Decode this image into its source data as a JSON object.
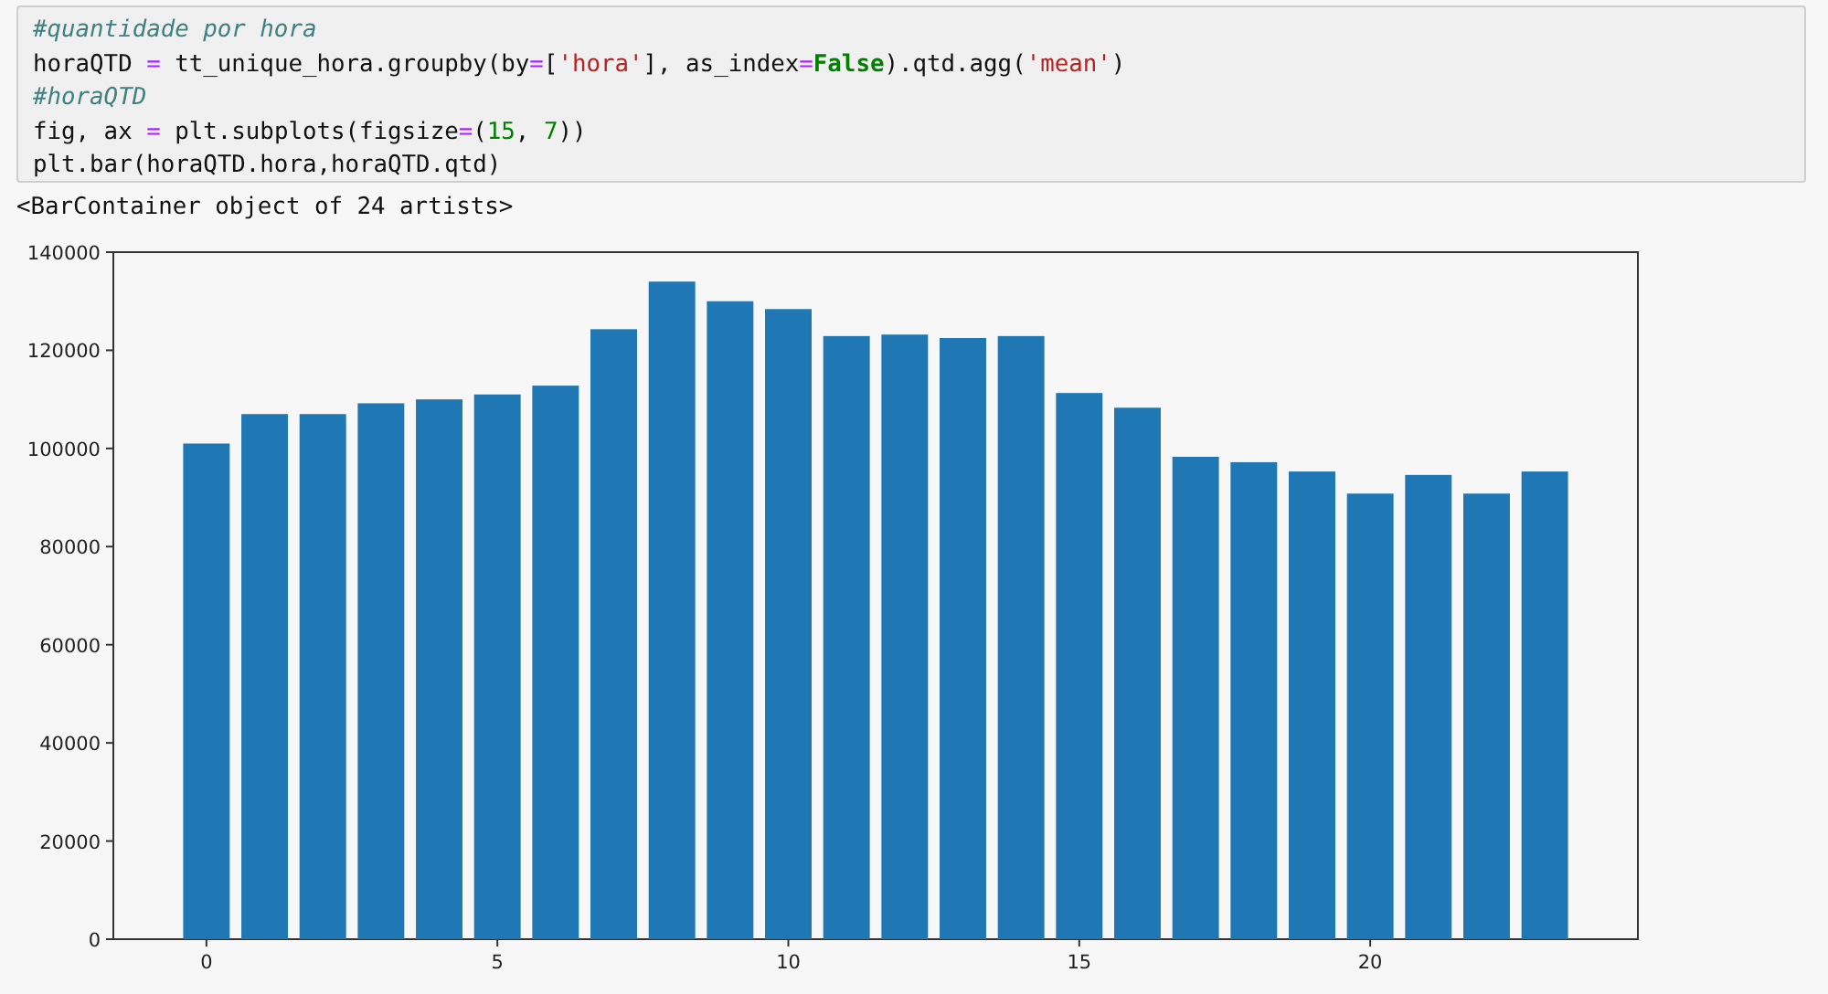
{
  "code_cell": {
    "lines": [
      [
        {
          "kind": "comment",
          "text": "#quantidade por hora"
        }
      ],
      [
        {
          "kind": "plain",
          "text": "horaQTD "
        },
        {
          "kind": "op",
          "text": "="
        },
        {
          "kind": "plain",
          "text": " tt_unique_hora.groupby(by"
        },
        {
          "kind": "op",
          "text": "="
        },
        {
          "kind": "plain",
          "text": "["
        },
        {
          "kind": "string",
          "text": "'hora'"
        },
        {
          "kind": "plain",
          "text": "], as_index"
        },
        {
          "kind": "op",
          "text": "="
        },
        {
          "kind": "keyword",
          "text": "False"
        },
        {
          "kind": "plain",
          "text": ").qtd.agg("
        },
        {
          "kind": "string",
          "text": "'mean'"
        },
        {
          "kind": "plain",
          "text": ")"
        }
      ],
      [
        {
          "kind": "comment",
          "text": "#horaQTD"
        }
      ],
      [
        {
          "kind": "plain",
          "text": "fig, ax "
        },
        {
          "kind": "op",
          "text": "="
        },
        {
          "kind": "plain",
          "text": " plt.subplots(figsize"
        },
        {
          "kind": "op",
          "text": "="
        },
        {
          "kind": "plain",
          "text": "("
        },
        {
          "kind": "number",
          "text": "15"
        },
        {
          "kind": "plain",
          "text": ", "
        },
        {
          "kind": "number",
          "text": "7"
        },
        {
          "kind": "plain",
          "text": "))"
        }
      ],
      [
        {
          "kind": "plain",
          "text": "plt.bar(horaQTD.hora,horaQTD.qtd)"
        }
      ]
    ]
  },
  "output": {
    "text": "<BarContainer object of 24 artists>",
    "chart_data": {
      "type": "bar",
      "x": [
        0,
        1,
        2,
        3,
        4,
        5,
        6,
        7,
        8,
        9,
        10,
        11,
        12,
        13,
        14,
        15,
        16,
        17,
        18,
        19,
        20,
        21,
        22,
        23
      ],
      "series": [
        {
          "color": "#1f77b4",
          "values": [
            101000,
            107000,
            107000,
            109200,
            110000,
            111000,
            112800,
            124300,
            134000,
            130000,
            128400,
            122900,
            123200,
            122500,
            122900,
            111300,
            108300,
            98300,
            97200,
            95300,
            90800,
            94600,
            90800,
            95300
          ]
        }
      ],
      "xlim": [
        -1.6,
        24.6
      ],
      "ylim": [
        0,
        140000
      ],
      "xticks": [
        0,
        5,
        10,
        15,
        20
      ],
      "yticks": [
        0,
        20000,
        40000,
        60000,
        80000,
        100000,
        120000,
        140000
      ]
    }
  }
}
